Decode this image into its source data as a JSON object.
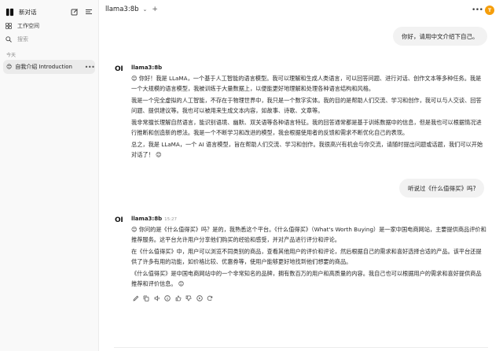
{
  "sidebar": {
    "new_chat_label": "新对话",
    "workspace_label": "工作空间",
    "search_placeholder": "搜索",
    "section_today": "今天",
    "chats": [
      {
        "emoji": "😊",
        "title": "自我介绍 Introduction",
        "active": true
      }
    ]
  },
  "header": {
    "model_name": "llama3:8b",
    "avatar_initial": "T",
    "accent_color": "#f59e0b"
  },
  "messages": [
    {
      "role": "user",
      "text": "你好，请用中文介绍下自己。"
    },
    {
      "role": "assistant",
      "name": "llama3:8b",
      "time": "",
      "paragraphs": [
        "😊 你好！我是 LLaMA，一个基于人工智能的语言模型。我可以理解和生成人类语言，可以回答问题、进行对话、创作文本等多种任务。我是一个大规模的语言模型，我被训练于大量数据上，以便能更好地理解和处理各种语言结构和风格。",
        "我是一个完全虚拟的人工智能，不存在于物理世界中，我只是一个数字实体。我的目的是帮助人们交流、学习和创作，我可以与人交谈、回答问题、提供建议等。我也可以被用来生成文本内容，如故事、诗歌、文章等。",
        "我非常擅长理解自然语言，能识别语境、幽默、双关语等各种语言特征。我的回答通常都是基于训练数据中的信息，但是我也可以根据情况进行推断和创造新的想法。我是一个不断学习和改进的模型，我会根据使用者的反馈和需求不断优化自己的表现。",
        "总之，我是 LLaMA，一个 AI 语言模型，旨在帮助人们交流、学习和创作。我很高兴有机会与你交流，请随时提出问题或话题，我们可以开始对话了！ 😊"
      ]
    },
    {
      "role": "user",
      "text": "听说过《什么值得买》吗?"
    },
    {
      "role": "assistant",
      "name": "llama3:8b",
      "time": "15:27",
      "paragraphs": [
        "😊 你问的是《什么值得买》吗？是的，我熟悉这个平台。《什么值得买》（What's Worth Buying）是一家中国电商网站，主要提供商品评价和推荐服务。这平台允许用户分享他们购买的经验和感受，并对产品进行评分和评论。",
        "在《什么值得买》中，用户可以浏览不同类别的商品，查看其他用户的评价和评论，然后根据自己的需求和喜好选择合适的产品。该平台还提供了许多有用的功能，如价格比较、优惠券等，使用户能够更好地找到他们想要的商品。",
        "《什么值得买》是中国电商网站中的一个非常知名的品牌，拥有数百万的用户和高质量的内容。我自己也可以根据用户的需求和喜好提供商品推荐和评价信息。 😊"
      ]
    }
  ],
  "action_icons": [
    "edit-icon",
    "copy-icon",
    "speaker-icon",
    "info-icon",
    "thumbs-up-icon",
    "thumbs-down-icon",
    "continue-icon",
    "regenerate-icon"
  ]
}
